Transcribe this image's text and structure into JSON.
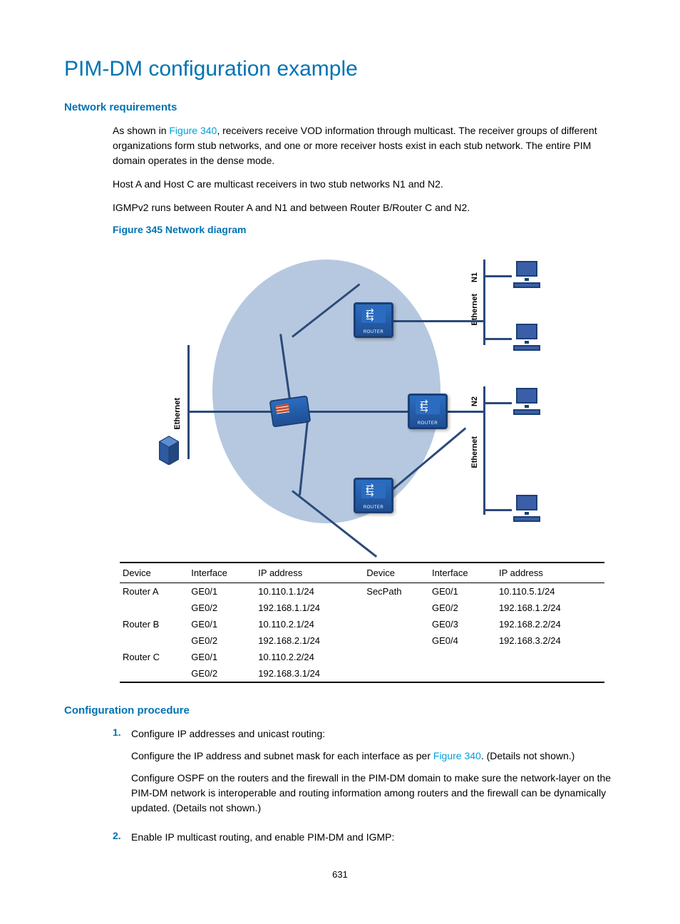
{
  "title": "PIM-DM configuration example",
  "sections": {
    "network_requirements": "Network requirements",
    "config_procedure": "Configuration procedure"
  },
  "paragraphs": {
    "nr1_pre": "As shown in ",
    "nr1_link": "Figure 340",
    "nr1_post": ", receivers receive VOD information through multicast. The receiver groups of different organizations form stub networks, and one or more receiver hosts exist in each stub network. The entire PIM domain operates in the dense mode.",
    "nr2": "Host A and Host C are multicast receivers in two stub networks N1 and N2.",
    "nr3": "IGMPv2 runs between Router A and N1 and between Router B/Router C and N2."
  },
  "figure": {
    "label": "Figure 345 Network diagram",
    "labels": {
      "eth": "Ethernet",
      "n1": "N1",
      "n2": "N2",
      "router_caption": "ROUTER"
    }
  },
  "table": {
    "headers": [
      "Device",
      "Interface",
      "IP address",
      "Device",
      "Interface",
      "IP address"
    ],
    "rows": [
      [
        "Router A",
        "GE0/1",
        "10.110.1.1/24",
        "SecPath",
        "GE0/1",
        "10.110.5.1/24"
      ],
      [
        "",
        "GE0/2",
        "192.168.1.1/24",
        "",
        "GE0/2",
        "192.168.1.2/24"
      ],
      [
        "Router B",
        "GE0/1",
        "10.110.2.1/24",
        "",
        "GE0/3",
        "192.168.2.2/24"
      ],
      [
        "",
        "GE0/2",
        "192.168.2.1/24",
        "",
        "GE0/4",
        "192.168.3.2/24"
      ],
      [
        "Router C",
        "GE0/1",
        "10.110.2.2/24",
        "",
        "",
        ""
      ],
      [
        "",
        "GE0/2",
        "192.168.3.1/24",
        "",
        "",
        ""
      ]
    ]
  },
  "procedure": {
    "step1_num": "1.",
    "step1_head": "Configure IP addresses and unicast routing:",
    "step1_p1_pre": "Configure the IP address and subnet mask for each interface as per ",
    "step1_p1_link": "Figure 340",
    "step1_p1_post": ". (Details not shown.)",
    "step1_p2": "Configure OSPF on the routers and the firewall in the PIM-DM domain to make sure the network-layer on the PIM-DM network is interoperable and routing information among routers and the firewall can be dynamically updated. (Details not shown.)",
    "step2_num": "2.",
    "step2_head": "Enable IP multicast routing, and enable PIM-DM and IGMP:"
  },
  "page_number": "631"
}
